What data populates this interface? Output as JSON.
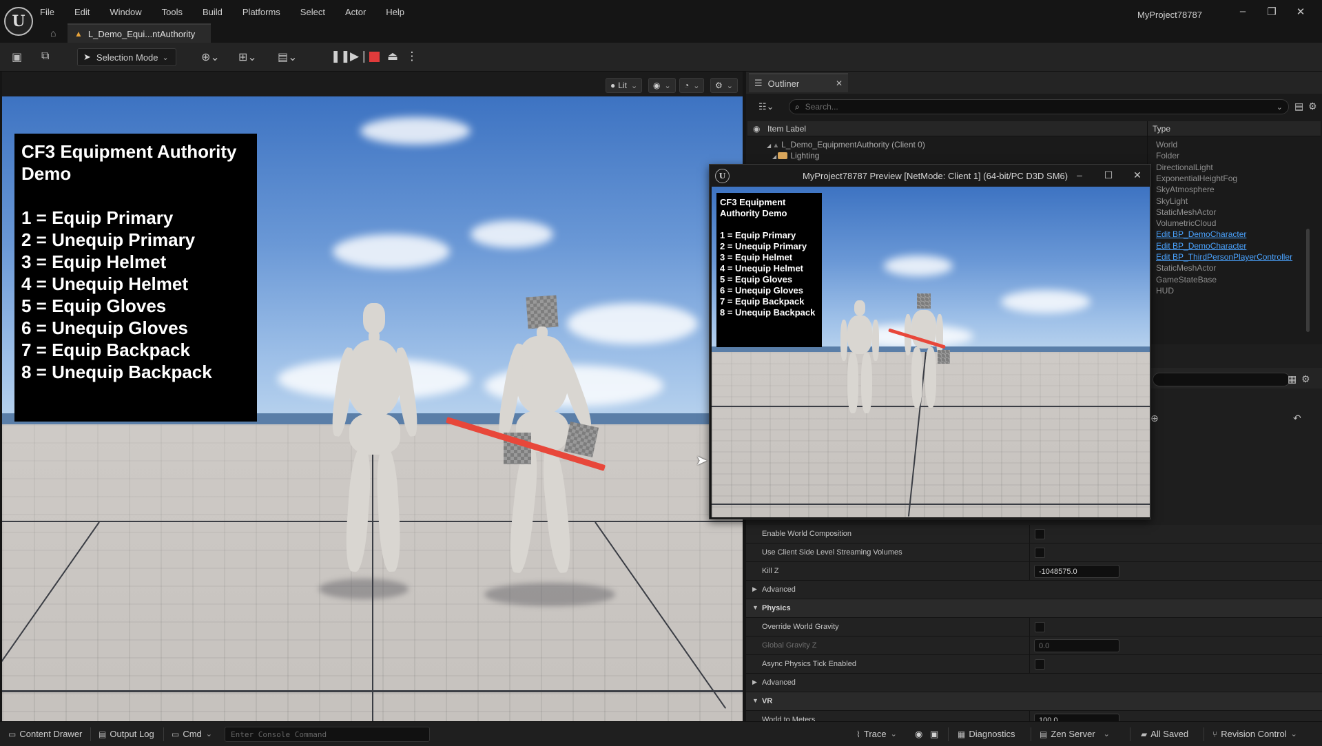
{
  "app": {
    "logo_label": "U",
    "project_title": "MyProject78787",
    "window_controls": [
      "–",
      "❐",
      "✕"
    ]
  },
  "menu": [
    "File",
    "Edit",
    "Window",
    "Tools",
    "Build",
    "Platforms",
    "Select",
    "Actor",
    "Help"
  ],
  "level_tab": {
    "name": "L_Demo_Equi...ntAuthority"
  },
  "toolbar": {
    "selection_mode": "Selection Mode",
    "icons": [
      "save-icon",
      "browse-icon",
      "add-actor-icon",
      "blueprint-icon",
      "cinematics-icon",
      "pause-icon",
      "step-icon",
      "stop-icon",
      "eject-icon",
      "more-icon"
    ]
  },
  "viewport": {
    "lit_label": "Lit",
    "help_title": "CF3 Equipment Authority Demo",
    "help_lines": [
      "1 = Equip Primary",
      "2 = Unequip Primary",
      "3 = Equip Helmet",
      "4 = Unequip Helmet",
      "5 = Equip Gloves",
      "6 = Unequip Gloves",
      "7 = Equip Backpack",
      "8 = Unequip Backpack"
    ]
  },
  "outliner": {
    "tab_label": "Outliner",
    "search_placeholder": "Search...",
    "col_item_label": "Item Label",
    "col_type": "Type",
    "rows": [
      {
        "name": "L_Demo_EquipmentAuthority (Client 0)",
        "type": "World",
        "link": false
      },
      {
        "name": "Lighting",
        "type": "Folder",
        "link": false
      },
      {
        "name": "",
        "type": "DirectionalLight",
        "link": false
      },
      {
        "name": "",
        "type": "ExponentialHeightFog",
        "link": false
      },
      {
        "name": "",
        "type": "SkyAtmosphere",
        "link": false
      },
      {
        "name": "",
        "type": "SkyLight",
        "link": false
      },
      {
        "name": "",
        "type": "StaticMeshActor",
        "link": false
      },
      {
        "name": "",
        "type": "VolumetricCloud",
        "link": false
      },
      {
        "name": "",
        "type": "Edit BP_DemoCharacter",
        "link": true
      },
      {
        "name": "",
        "type": "Edit BP_DemoCharacter",
        "link": true
      },
      {
        "name": "",
        "type": "Edit BP_ThirdPersonPlayerController",
        "link": true
      },
      {
        "name": "",
        "type": "StaticMeshActor",
        "link": false
      },
      {
        "name": "",
        "type": "GameStateBase",
        "link": false
      },
      {
        "name": "",
        "type": "HUD",
        "link": false
      }
    ]
  },
  "details": {
    "rows": [
      {
        "label": "Enable World Composition",
        "kind": "checkbox"
      },
      {
        "label": "Use Client Side Level Streaming Volumes",
        "kind": "checkbox"
      },
      {
        "label": "Kill Z",
        "kind": "number",
        "value": "-1048575.0"
      },
      {
        "label": "Advanced",
        "kind": "collapsed"
      },
      {
        "label": "Physics",
        "kind": "category"
      },
      {
        "label": "Override World Gravity",
        "kind": "checkbox"
      },
      {
        "label": "Global Gravity Z",
        "kind": "number-dim",
        "value": "0.0"
      },
      {
        "label": "Async Physics Tick Enabled",
        "kind": "checkbox"
      },
      {
        "label": "Advanced",
        "kind": "collapsed"
      },
      {
        "label": "VR",
        "kind": "category"
      },
      {
        "label": "World to Meters",
        "kind": "number",
        "value": "100.0"
      }
    ]
  },
  "preview": {
    "title": "MyProject78787 Preview [NetMode: Client 1]  (64-bit/PC D3D SM6)",
    "logo_label": "U",
    "window_controls": [
      "–",
      "☐",
      "✕"
    ]
  },
  "statusbar": {
    "content_drawer": "Content Drawer",
    "output_log": "Output Log",
    "cmd": "Cmd",
    "console_placeholder": "Enter Console Command",
    "trace": "Trace",
    "diagnostics": "Diagnostics",
    "zen_server": "Zen Server",
    "all_saved": "All Saved",
    "revision_control": "Revision Control"
  }
}
